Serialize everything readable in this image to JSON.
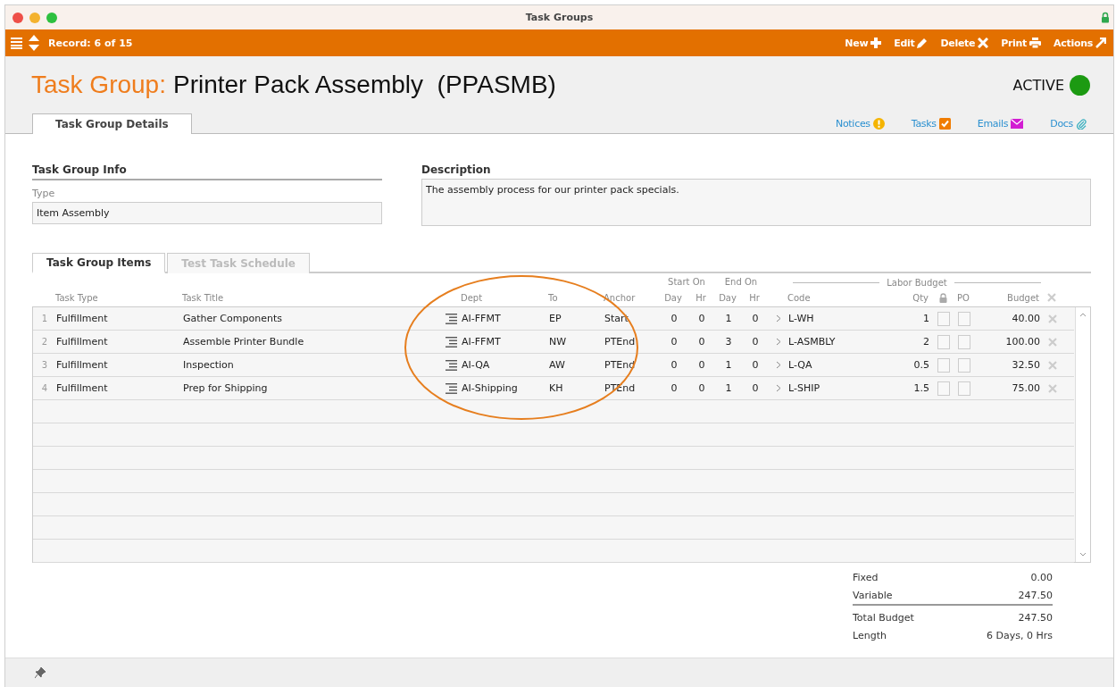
{
  "window": {
    "title": "Task Groups"
  },
  "toolbar": {
    "record": "Record: 6 of 15",
    "actions": [
      {
        "label": "New",
        "kind": "new"
      },
      {
        "label": "Edit",
        "kind": "edit"
      },
      {
        "label": "Delete",
        "kind": "delete"
      },
      {
        "label": "Print",
        "kind": "print"
      },
      {
        "label": "Actions",
        "kind": "actions"
      }
    ]
  },
  "header": {
    "prefix": "Task Group:",
    "name": "Printer Pack Assembly  (PPASMB)",
    "status": "ACTIVE"
  },
  "tabs": [
    {
      "label": "Task Group Details",
      "selected": true
    }
  ],
  "links": [
    {
      "label": "Notices",
      "kind": "notices"
    },
    {
      "label": "Tasks",
      "kind": "tasks"
    },
    {
      "label": "Emails",
      "kind": "emails"
    },
    {
      "label": "Docs",
      "kind": "docs"
    }
  ],
  "info": {
    "heading": "Task Group Info",
    "type_label": "Type",
    "type_value": "Item Assembly"
  },
  "description": {
    "heading": "Description",
    "value": "The assembly process for our printer pack specials."
  },
  "item_tabs": [
    {
      "label": "Task Group Items",
      "selected": true
    },
    {
      "label": "Test Task Schedule",
      "selected": false,
      "disabled": true
    }
  ],
  "table": {
    "groups": {
      "start_on": "Start On",
      "end_on": "End On",
      "labor_budget": "Labor Budget"
    },
    "columns": {
      "task_type": "Task Type",
      "task_title": "Task Title",
      "dept": "Dept",
      "to": "To",
      "anchor": "Anchor",
      "start_day": "Day",
      "start_hr": "Hr",
      "end_day": "Day",
      "end_hr": "Hr",
      "code": "Code",
      "qty": "Qty",
      "po": "PO",
      "budget": "Budget"
    },
    "rows": [
      {
        "num": "1",
        "task_type": "Fulfillment",
        "task_title": "Gather Components",
        "dept": "AI-FFMT",
        "to": "EP",
        "anchor": "Start",
        "start_day": "0",
        "start_hr": "0",
        "end_day": "1",
        "end_hr": "0",
        "code": "L-WH",
        "qty": "1",
        "locked": false,
        "po": false,
        "budget": "40.00"
      },
      {
        "num": "2",
        "task_type": "Fulfillment",
        "task_title": "Assemble Printer Bundle",
        "dept": "AI-FFMT",
        "to": "NW",
        "anchor": "PTEnd",
        "start_day": "0",
        "start_hr": "0",
        "end_day": "3",
        "end_hr": "0",
        "code": "L-ASMBLY",
        "qty": "2",
        "locked": false,
        "po": false,
        "budget": "100.00"
      },
      {
        "num": "3",
        "task_type": "Fulfillment",
        "task_title": "Inspection",
        "dept": "AI-QA",
        "to": "AW",
        "anchor": "PTEnd",
        "start_day": "0",
        "start_hr": "0",
        "end_day": "1",
        "end_hr": "0",
        "code": "L-QA",
        "qty": "0.5",
        "locked": false,
        "po": false,
        "budget": "32.50"
      },
      {
        "num": "4",
        "task_type": "Fulfillment",
        "task_title": "Prep for Shipping",
        "dept": "AI-Shipping",
        "to": "KH",
        "anchor": "PTEnd",
        "start_day": "0",
        "start_hr": "0",
        "end_day": "1",
        "end_hr": "0",
        "code": "L-SHIP",
        "qty": "1.5",
        "locked": false,
        "po": false,
        "budget": "75.00"
      }
    ]
  },
  "totals": [
    {
      "label": "Fixed",
      "value": "0.00"
    },
    {
      "label": "Variable",
      "value": "247.50"
    },
    {
      "label": "Total Budget",
      "value": "247.50"
    },
    {
      "label": "Length",
      "value": "6 Days, 0 Hrs"
    }
  ]
}
